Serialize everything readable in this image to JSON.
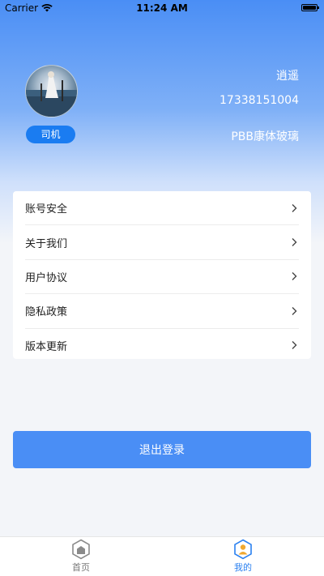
{
  "status_bar": {
    "carrier": "Carrier",
    "time": "11:24 AM"
  },
  "profile": {
    "role": "司机",
    "name": "逍遥",
    "phone": "17338151004",
    "company": "PBB康体玻璃"
  },
  "menu": {
    "items": [
      {
        "label": "账号安全"
      },
      {
        "label": "关于我们"
      },
      {
        "label": "用户协议"
      },
      {
        "label": "隐私政策"
      },
      {
        "label": "版本更新"
      }
    ]
  },
  "logout": {
    "label": "退出登录"
  },
  "tab_bar": {
    "tabs": [
      {
        "label": "首页",
        "icon": "home-icon",
        "active": false
      },
      {
        "label": "我的",
        "icon": "user-icon",
        "active": true
      }
    ]
  },
  "colors": {
    "primary": "#4a8ef5",
    "badge": "#1a7cf1",
    "active_tab": "#2a80f0"
  }
}
